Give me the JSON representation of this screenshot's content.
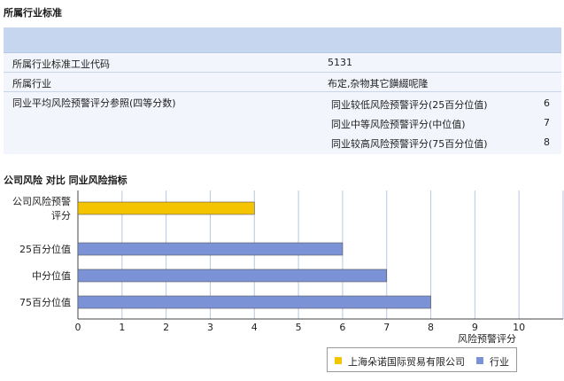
{
  "section1_title": "所属行业标准",
  "table": {
    "rows": [
      {
        "label": "所属行业标准工业代码",
        "value": "5131"
      },
      {
        "label": "所属行业",
        "value": "布定,杂物其它鐄綴呢隆"
      }
    ],
    "benchmark": {
      "label": "同业平均风险预警评分参照(四等分数)",
      "items": [
        {
          "label": "同业较低风险预警评分(25百分位值)",
          "value": "6"
        },
        {
          "label": "同业中等风险预警评分(中位值)",
          "value": "7"
        },
        {
          "label": "同业较高风险预警评分(75百分位值)",
          "value": "8"
        }
      ]
    }
  },
  "section2_title": "公司风险 对比 同业风险指标",
  "chart_data": {
    "type": "bar",
    "orientation": "horizontal",
    "categories": [
      "公司风险预警评分",
      "25百分位值",
      "中分位值",
      "75百分位值"
    ],
    "category_lines": [
      [
        "公司风险预警",
        "评分"
      ],
      [
        "25百分位值"
      ],
      [
        "中分位值"
      ],
      [
        "75百分位值"
      ]
    ],
    "series": [
      {
        "name": "上海朵诺国际贸易有限公司",
        "color": "#f5c400",
        "values": [
          4,
          null,
          null,
          null
        ]
      },
      {
        "name": "行业",
        "color": "#7b93d6",
        "values": [
          null,
          6,
          7,
          8
        ]
      }
    ],
    "xlabel": "风险预警评分",
    "xlim": [
      0,
      11
    ],
    "xticks": [
      0,
      1,
      2,
      3,
      4,
      5,
      6,
      7,
      8,
      9,
      10
    ],
    "grid": true,
    "legend_position": "bottom-right"
  }
}
